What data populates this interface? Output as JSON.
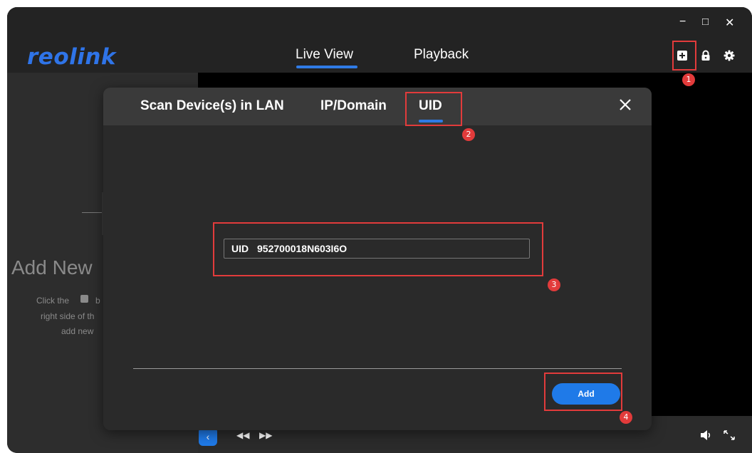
{
  "app": {
    "logo": "reolink"
  },
  "nav": {
    "tabs": [
      {
        "label": "Live View"
      },
      {
        "label": "Playback"
      }
    ]
  },
  "window_controls": {
    "minimize": "−",
    "maximize": "□",
    "close": "✕"
  },
  "left_panel": {
    "title": "Add New",
    "hint_line1_a": "Click the",
    "hint_line1_b": "b",
    "hint_line2": "right side of th",
    "hint_line3": "add new"
  },
  "modal": {
    "tabs": [
      {
        "label": "Scan Device(s) in LAN"
      },
      {
        "label": "IP/Domain"
      },
      {
        "label": "UID"
      }
    ],
    "active_tab": "UID",
    "uid_label": "UID",
    "uid_value": "952700018N603I6O",
    "add_label": "Add"
  },
  "badges": [
    "1",
    "2",
    "3",
    "4"
  ],
  "icons": {
    "toolbar": [
      "add-device-icon",
      "lock-icon",
      "gear-icon"
    ],
    "bottom": [
      "chevron-left-icon",
      "rewind-icon",
      "fast-forward-icon",
      "volume-icon",
      "fullscreen-icon"
    ]
  },
  "colors": {
    "accent": "#1f7ae8",
    "annotation": "#e23b3b",
    "logo": "#2f74e8"
  }
}
